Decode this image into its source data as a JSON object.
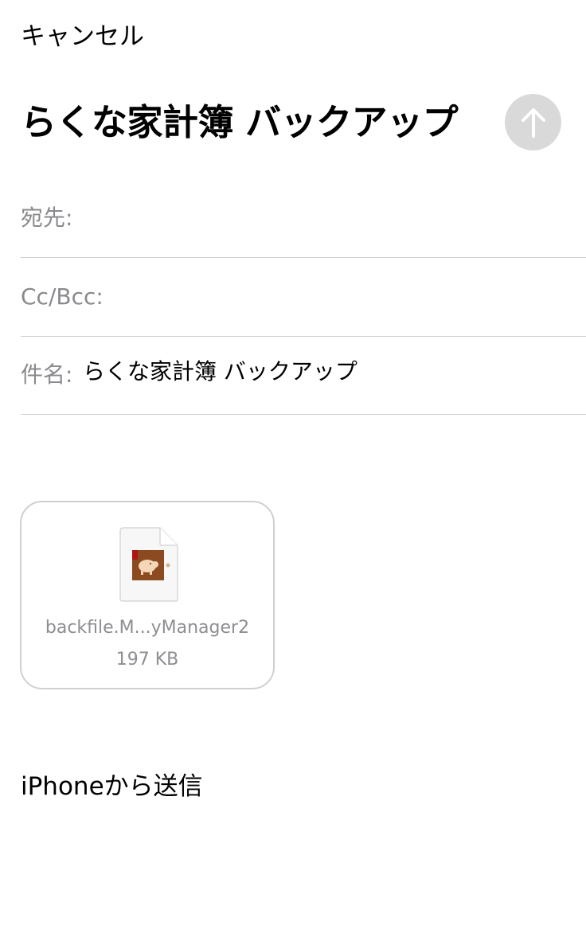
{
  "header": {
    "cancel_label": "キャンセル",
    "title": "らくな家計簿 バックアップ",
    "send_icon": "arrow-up-icon",
    "send_button_color": "#d9d9d9"
  },
  "fields": {
    "to_label": "宛先:",
    "to_value": "",
    "cc_label": "Cc/Bcc:",
    "cc_value": "",
    "subject_label": "件名:",
    "subject_value": "らくな家計簿 バックアップ"
  },
  "attachment": {
    "icon": "piggy-bank-file-icon",
    "name": "backfile.M...yManager2",
    "size": "197 KB",
    "icon_color": "#8b4a1f"
  },
  "body": {
    "signature": "iPhoneから送信"
  }
}
